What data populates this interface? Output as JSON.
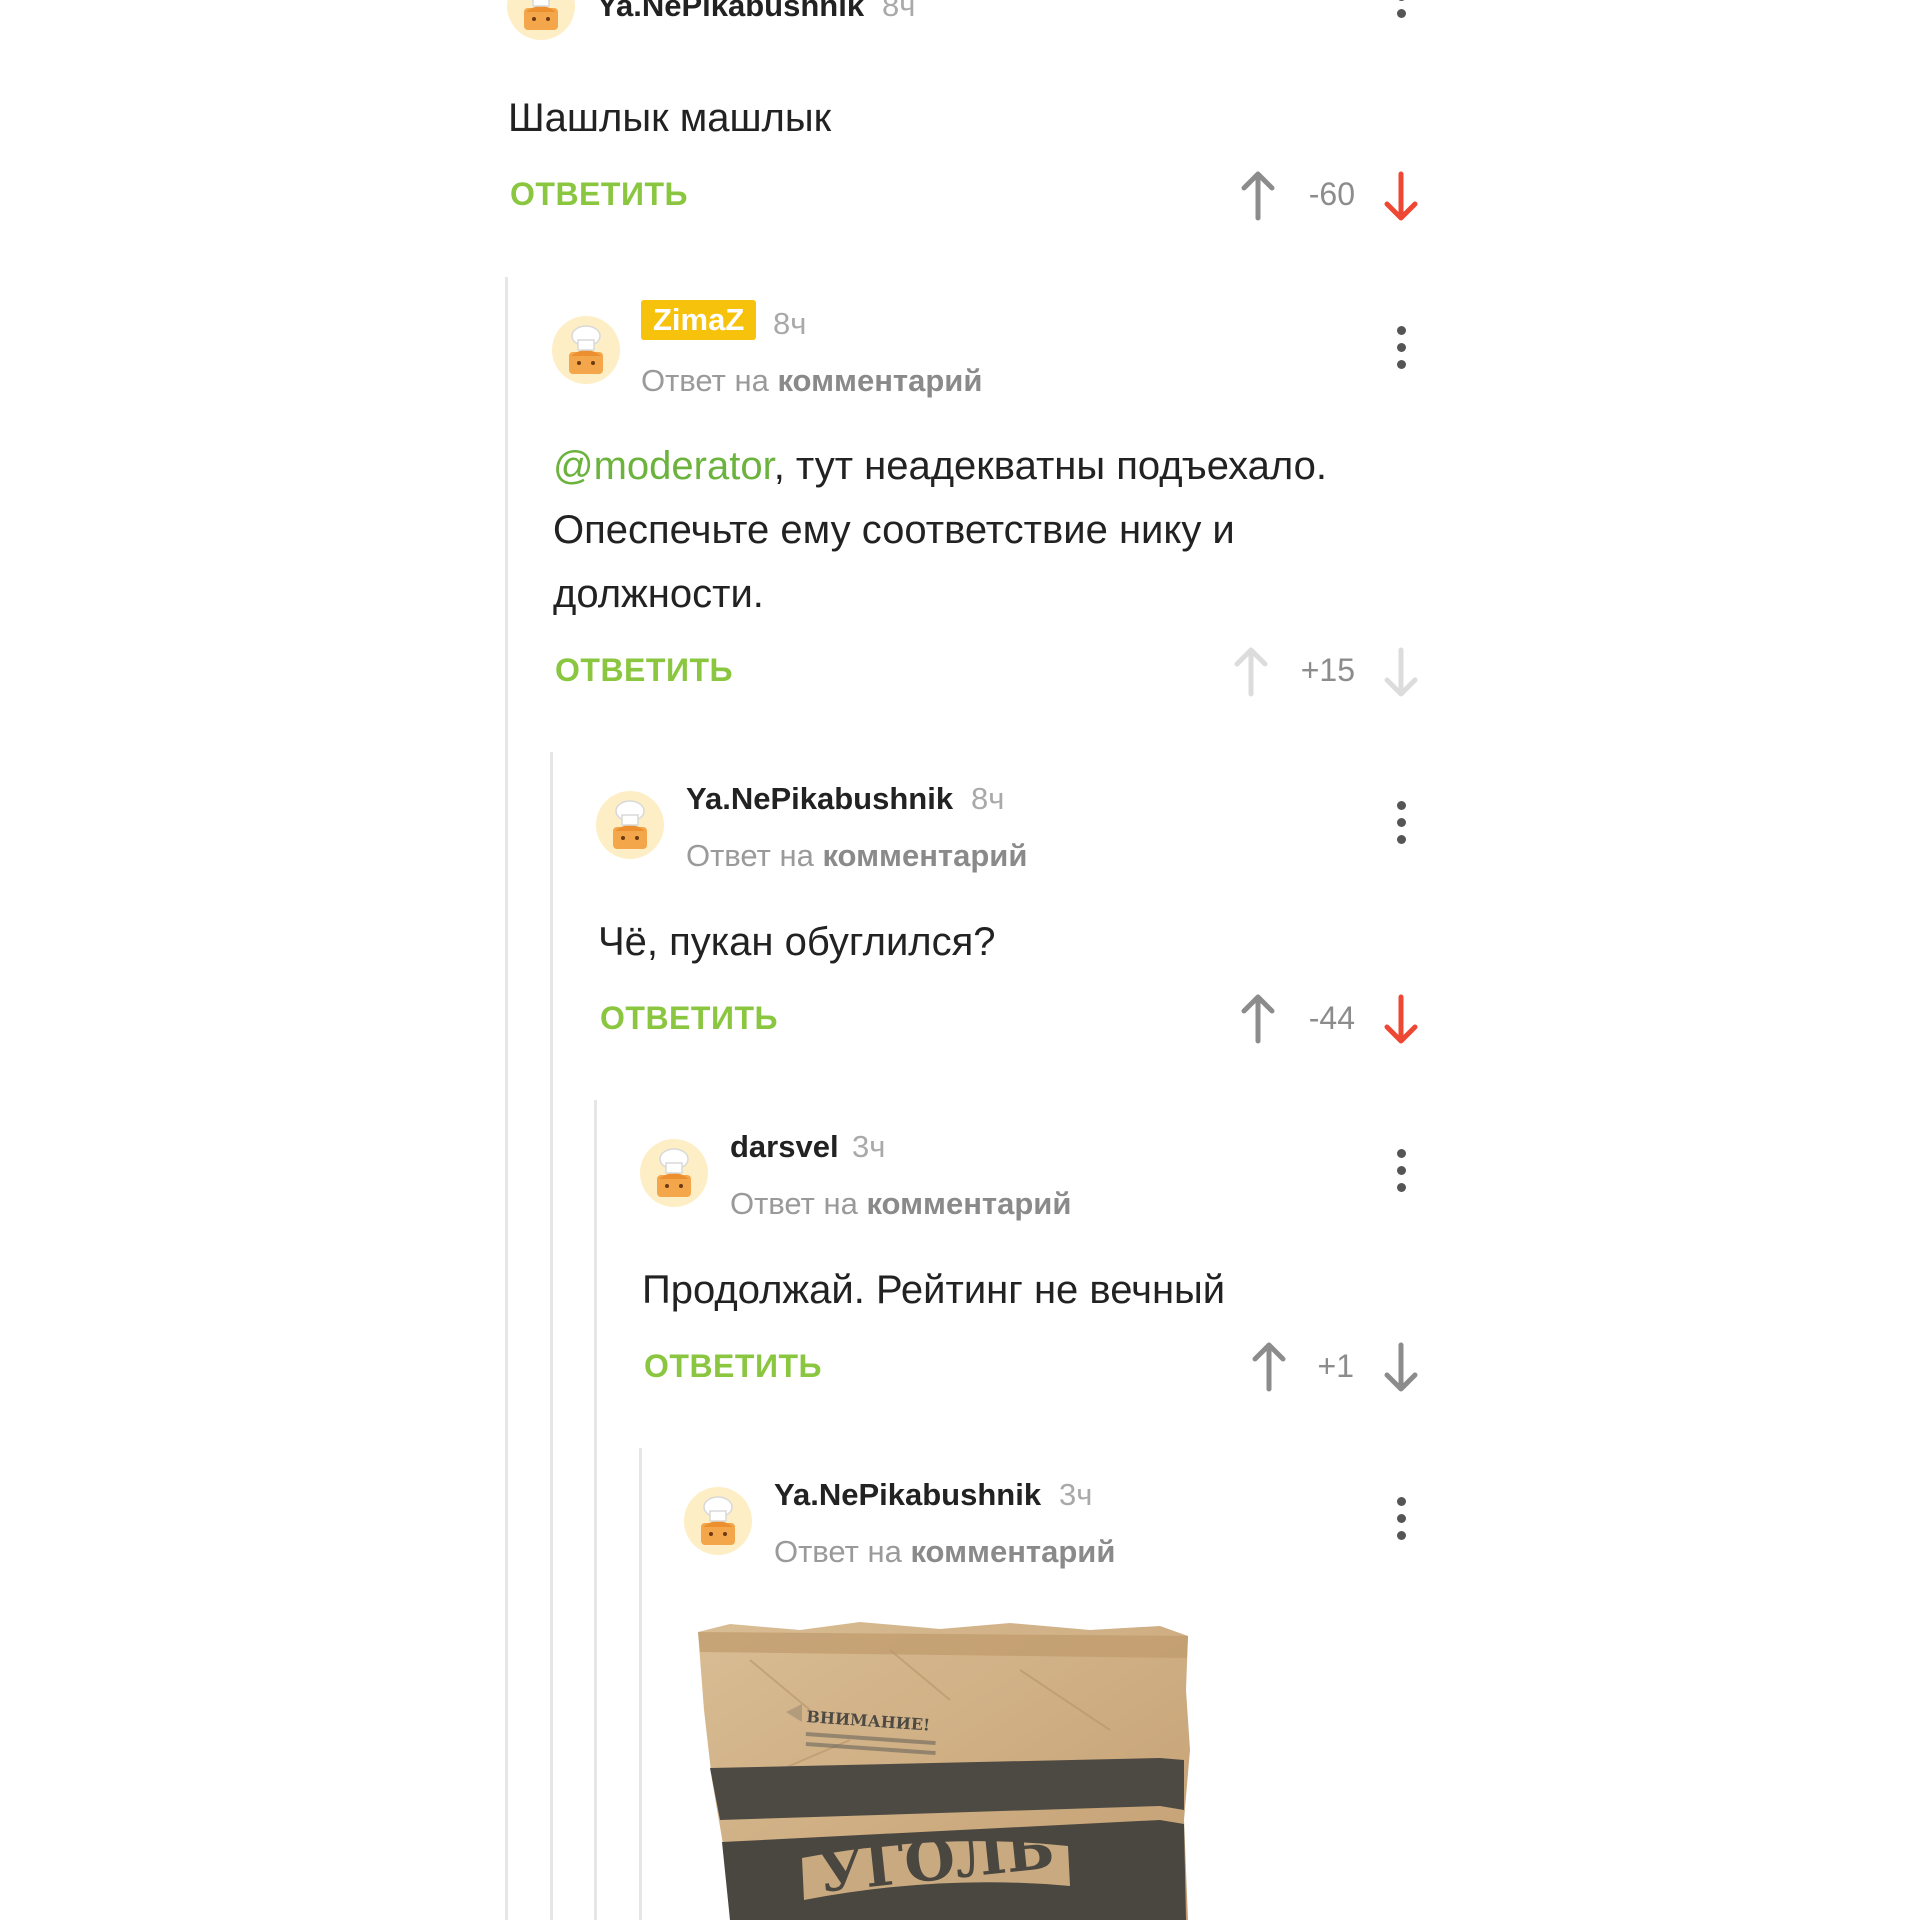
{
  "icons": {
    "avatar": "chef-avatar-icon",
    "menu": "vertical-dots-menu-icon",
    "upvote": "arrow-up-icon",
    "downvote": "arrow-down-icon"
  },
  "colors": {
    "accent_green": "#8ac640",
    "mention_green": "#6cb33e",
    "downvote_active": "#ee4734",
    "vote_neutral": "#8c8c8c",
    "vote_faded": "#dcdcdc",
    "badge_yellow": "#f6c20c"
  },
  "comments": [
    {
      "author": "Ya.NePikabushnik",
      "time": "8ч",
      "text": "Шашлык машлык",
      "reply_label": "ОТВЕТИТЬ",
      "rating": "-60",
      "vote_state": "downvoted"
    },
    {
      "author": "ZimaZ",
      "time": "8ч",
      "reply_to_prefix": "Ответ на",
      "reply_to_link": "комментарий",
      "mention": "@moderator",
      "text_line1_rest": ", тут неадекватны подъехало.",
      "text_line2": "Опеспечьте ему соответствие нику и",
      "text_line3": "должности.",
      "reply_label": "ОТВЕТИТЬ",
      "rating": "+15",
      "vote_state": "none"
    },
    {
      "author": "Ya.NePikabushnik",
      "time": "8ч",
      "reply_to_prefix": "Ответ на",
      "reply_to_link": "комментарий",
      "text": "Чё, пукан обуглился?",
      "reply_label": "ОТВЕТИТЬ",
      "rating": "-44",
      "vote_state": "downvoted"
    },
    {
      "author": "darsvel",
      "time": "3ч",
      "reply_to_prefix": "Ответ на",
      "reply_to_link": "комментарий",
      "text": "Продолжай. Рейтинг не вечный",
      "reply_label": "ОТВЕТИТЬ",
      "rating": "+1",
      "vote_state": "neutral"
    },
    {
      "author": "Ya.NePikabushnik",
      "time": "3ч",
      "reply_to_prefix": "Ответ на",
      "reply_to_link": "комментарий",
      "image": {
        "bag_warning": "ВНИМАНИЕ!",
        "bag_label": "УГОЛЬ"
      }
    }
  ]
}
